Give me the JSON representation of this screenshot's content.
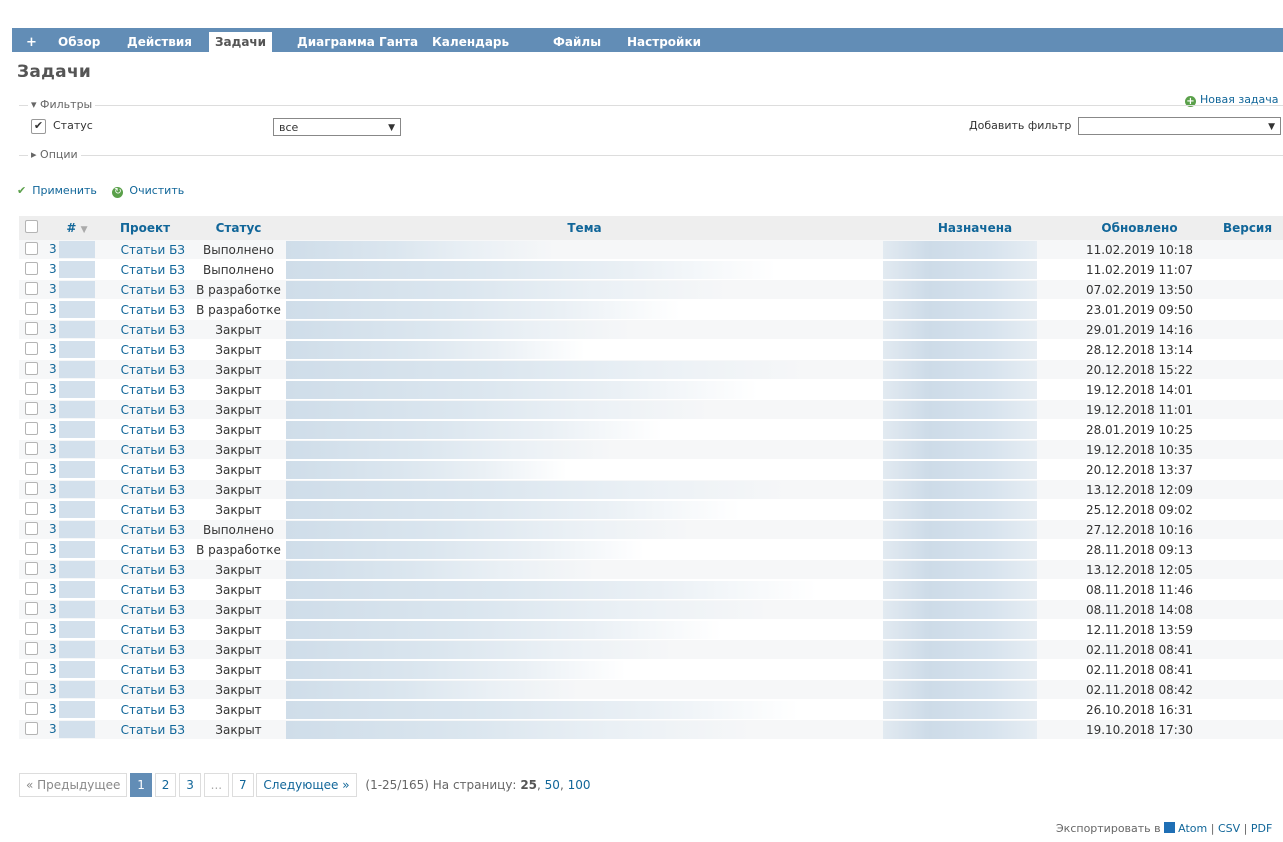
{
  "tabs": [
    {
      "label": "+",
      "active": false
    },
    {
      "label": "Обзор",
      "active": false
    },
    {
      "label": "Действия",
      "active": false
    },
    {
      "label": "Задачи",
      "active": true
    },
    {
      "label": "Диаграмма Ганта",
      "active": false
    },
    {
      "label": "Календарь",
      "active": false
    },
    {
      "label": "Файлы",
      "active": false
    },
    {
      "label": "Настройки",
      "active": false
    }
  ],
  "page_title": "Задачи",
  "new_task_label": "Новая задача",
  "filters": {
    "legend": "Фильтры",
    "status_label": "Статус",
    "status_checked": true,
    "status_value": "все",
    "add_filter_label": "Добавить фильтр",
    "add_filter_value": ""
  },
  "options_legend": "Опции",
  "actions": {
    "apply": "Применить",
    "clear": "Очистить"
  },
  "table": {
    "headers": {
      "id": "#",
      "project": "Проект",
      "status": "Статус",
      "subject": "Тема",
      "assignee": "Назначена",
      "updated": "Обновлено",
      "version": "Версия"
    },
    "rows": [
      {
        "id": "3",
        "project": "Статьи БЗ",
        "status": "Выполнено",
        "updated": "11.02.2019 10:18"
      },
      {
        "id": "3",
        "project": "Статьи БЗ",
        "status": "Выполнено",
        "updated": "11.02.2019 11:07"
      },
      {
        "id": "3",
        "project": "Статьи БЗ",
        "status": "В разработке",
        "updated": "07.02.2019 13:50"
      },
      {
        "id": "3",
        "project": "Статьи БЗ",
        "status": "В разработке",
        "updated": "23.01.2019 09:50"
      },
      {
        "id": "3",
        "project": "Статьи БЗ",
        "status": "Закрыт",
        "updated": "29.01.2019 14:16"
      },
      {
        "id": "3",
        "project": "Статьи БЗ",
        "status": "Закрыт",
        "updated": "28.12.2018 13:14"
      },
      {
        "id": "3",
        "project": "Статьи БЗ",
        "status": "Закрыт",
        "updated": "20.12.2018 15:22"
      },
      {
        "id": "3",
        "project": "Статьи БЗ",
        "status": "Закрыт",
        "updated": "19.12.2018 14:01"
      },
      {
        "id": "3",
        "project": "Статьи БЗ",
        "status": "Закрыт",
        "updated": "19.12.2018 11:01"
      },
      {
        "id": "3",
        "project": "Статьи БЗ",
        "status": "Закрыт",
        "updated": "28.01.2019 10:25"
      },
      {
        "id": "3",
        "project": "Статьи БЗ",
        "status": "Закрыт",
        "updated": "19.12.2018 10:35"
      },
      {
        "id": "3",
        "project": "Статьи БЗ",
        "status": "Закрыт",
        "updated": "20.12.2018 13:37"
      },
      {
        "id": "3",
        "project": "Статьи БЗ",
        "status": "Закрыт",
        "updated": "13.12.2018 12:09"
      },
      {
        "id": "3",
        "project": "Статьи БЗ",
        "status": "Закрыт",
        "updated": "25.12.2018 09:02"
      },
      {
        "id": "3",
        "project": "Статьи БЗ",
        "status": "Выполнено",
        "updated": "27.12.2018 10:16"
      },
      {
        "id": "3",
        "project": "Статьи БЗ",
        "status": "В разработке",
        "updated": "28.11.2018 09:13"
      },
      {
        "id": "3",
        "project": "Статьи БЗ",
        "status": "Закрыт",
        "updated": "13.12.2018 12:05"
      },
      {
        "id": "3",
        "project": "Статьи БЗ",
        "status": "Закрыт",
        "updated": "08.11.2018 11:46"
      },
      {
        "id": "3",
        "project": "Статьи БЗ",
        "status": "Закрыт",
        "updated": "08.11.2018 14:08"
      },
      {
        "id": "3",
        "project": "Статьи БЗ",
        "status": "Закрыт",
        "updated": "12.11.2018 13:59"
      },
      {
        "id": "3",
        "project": "Статьи БЗ",
        "status": "Закрыт",
        "updated": "02.11.2018 08:41"
      },
      {
        "id": "3",
        "project": "Статьи БЗ",
        "status": "Закрыт",
        "updated": "02.11.2018 08:41"
      },
      {
        "id": "3",
        "project": "Статьи БЗ",
        "status": "Закрыт",
        "updated": "02.11.2018 08:42"
      },
      {
        "id": "3",
        "project": "Статьи БЗ",
        "status": "Закрыт",
        "updated": "26.10.2018 16:31"
      },
      {
        "id": "3",
        "project": "Статьи БЗ",
        "status": "Закрыт",
        "updated": "19.10.2018 17:30"
      }
    ]
  },
  "pagination": {
    "prev": "« Предыдущее",
    "pages": [
      "1",
      "2",
      "3",
      "...",
      "7"
    ],
    "current": "1",
    "next": "Следующее »",
    "range": "(1-25/165)",
    "per_page_label": "На страницу:",
    "per_page_current": "25",
    "per_page_options": [
      "50",
      "100"
    ]
  },
  "export": {
    "label": "Экспортировать в",
    "atom": "Atom",
    "csv": "CSV",
    "pdf": "PDF"
  },
  "colors": {
    "header_bar": "#628db6",
    "link": "#116699",
    "accent_green": "#5aa04a"
  }
}
